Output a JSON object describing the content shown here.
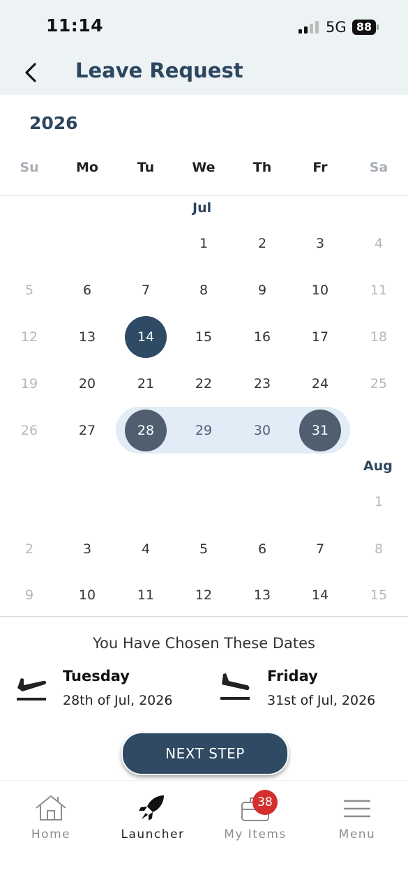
{
  "status_bar": {
    "time": "11:14",
    "network": "5G",
    "battery": "88"
  },
  "header": {
    "title": "Leave Request"
  },
  "calendar": {
    "year": "2026",
    "weekdays": [
      "Su",
      "Mo",
      "Tu",
      "We",
      "Th",
      "Fr",
      "Sa"
    ],
    "months": [
      {
        "name": "Jul",
        "weeks": [
          [
            "",
            "",
            "",
            "1",
            "2",
            "3",
            "4"
          ],
          [
            "5",
            "6",
            "7",
            "8",
            "9",
            "10",
            "11"
          ],
          [
            "12",
            "13",
            "14",
            "15",
            "16",
            "17",
            "18"
          ],
          [
            "19",
            "20",
            "21",
            "22",
            "23",
            "24",
            "25"
          ],
          [
            "26",
            "27",
            "28",
            "29",
            "30",
            "31",
            ""
          ]
        ]
      },
      {
        "name": "Aug",
        "weeks": [
          [
            "",
            "",
            "",
            "",
            "",
            "",
            "1"
          ],
          [
            "2",
            "3",
            "4",
            "5",
            "6",
            "7",
            "8"
          ],
          [
            "9",
            "10",
            "11",
            "12",
            "13",
            "14",
            "15"
          ]
        ]
      }
    ],
    "today": "14",
    "selected_start": "28",
    "selected_end": "31"
  },
  "summary": {
    "title": "You Have Chosen These Dates",
    "start": {
      "day": "Tuesday",
      "date": "28th of Jul, 2026"
    },
    "end": {
      "day": "Friday",
      "date": "31st of Jul, 2026"
    }
  },
  "next_button": "NEXT STEP",
  "bottom_nav": {
    "items": [
      {
        "label": "Home",
        "icon": "home-icon"
      },
      {
        "label": "Launcher",
        "icon": "rocket-icon"
      },
      {
        "label": "My Items",
        "icon": "briefcase-icon",
        "badge": "38"
      },
      {
        "label": "Menu",
        "icon": "menu-icon"
      }
    ],
    "active": "Launcher"
  },
  "colors": {
    "primary": "#2c4660",
    "range": "#e1ecf7",
    "badge": "#d32f2f",
    "header_bg": "#edf2f5"
  }
}
